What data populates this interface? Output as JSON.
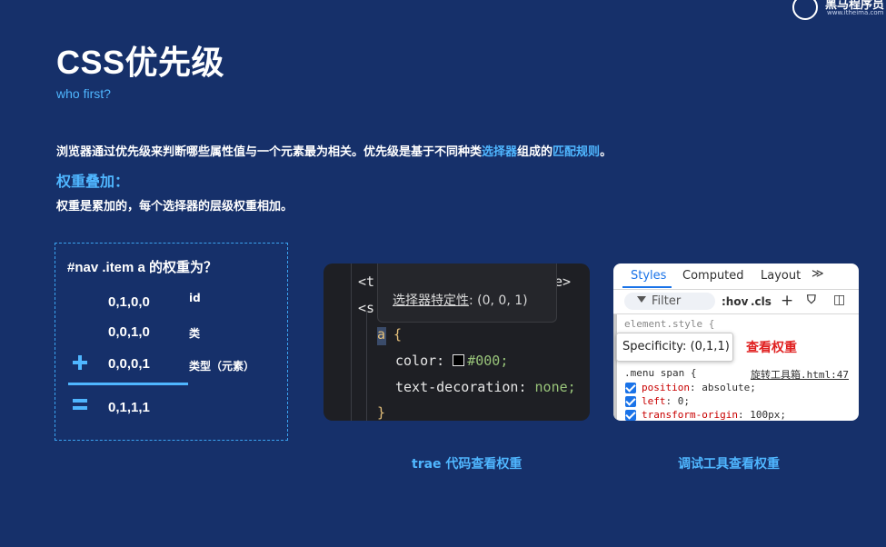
{
  "logo": {
    "name": "黑马程序员",
    "url": "www.itheima.com"
  },
  "title": "CSS优先级",
  "subtitle": "who first?",
  "intro": {
    "part1": "浏览器通过优先级来判断哪些属性值与一个元素最为相关。优先级是基于不同种类",
    "hl1": "选择器",
    "part2": "组成的",
    "hl2": "匹配规则",
    "part3": "。"
  },
  "section": {
    "title": "权重叠加：",
    "desc": "权重是累加的，每个选择器的层级权重相加。"
  },
  "box": {
    "question": "#nav .item a  的权重为？",
    "rows": [
      {
        "value": "0,1,0,0",
        "label": "id"
      },
      {
        "value": "0,0,1,0",
        "label": "类"
      },
      {
        "value": "0,0,0,1",
        "label": "类型（元素）"
      }
    ],
    "result": "0,1,1,1"
  },
  "code": {
    "tooltip_label": "选择器特定性",
    "tooltip_value": ": (0, 0, 1)",
    "line1_start": "<t",
    "line1_end": "e>",
    "line2_start": "<s",
    "selector": "a",
    "open_brace": " {",
    "prop1": "color: ",
    "val1": "#000;",
    "prop2": "text-decoration: ",
    "val2": "none;",
    "close_brace": "}"
  },
  "devtools": {
    "tabs": [
      "Styles",
      "Computed",
      "Layout"
    ],
    "more": "≫",
    "filter_placeholder": "Filter",
    "hov": ":hov",
    "cls": ".cls",
    "element_style": "element.style {",
    "specificity": "Specificity: (0,1,1)",
    "note": "查看权重",
    "rule_selector": ".menu span {",
    "rule_source": "旋转工具箱.html:47",
    "props": [
      {
        "name": "position",
        "value": ": absolute;"
      },
      {
        "name": "left",
        "value": ": 0;"
      },
      {
        "name": "transform-origin",
        "value": ": 100px;"
      }
    ]
  },
  "captions": {
    "code": "trae 代码查看权重",
    "devtools": "调试工具查看权重"
  },
  "colors": {
    "background": "#16306a",
    "accent": "#4fb6ff",
    "note_red": "#e02020"
  }
}
